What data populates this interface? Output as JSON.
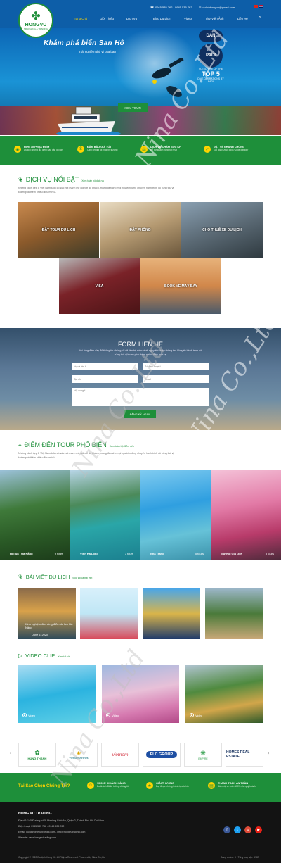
{
  "header": {
    "logo": {
      "name": "HONGVU",
      "tagline": "TRAVELING & TRADING"
    },
    "phone": "0945 535 762 - 0945 535 762",
    "email": "dulichhongvu@gmail.com",
    "nav": [
      "Trang Chủ",
      "Giới Thiệu",
      "Dịch Vụ",
      "Blog Du Lịch",
      "Video",
      "Thư Viện Ảnh",
      "Liên Hệ"
    ],
    "active_nav": "Trang Chủ",
    "colors": {
      "primary_blue": "#0d5ea8",
      "primary_green": "#1e8f3a",
      "accent_yellow": "#ffd400"
    }
  },
  "hero": {
    "title": "Khám phá biển San Hô",
    "subtitle": "Trải nghiệm thú vị của bạn",
    "button": "XEM TOUR",
    "badge_dan": "DAN",
    "badge_padi": "PADI",
    "rank_top": "VOTED ONE OF THE",
    "rank_big": "TOP 5",
    "rank_bottom": "DIVE OPERATIONS BY PADI"
  },
  "features": [
    {
      "title": "HƠN 300+ ĐỊA ĐIỂM",
      "desc": "Du lịch những địa điểm hấp dẫn du lịch",
      "icon": "map-icon"
    },
    {
      "title": "ĐẢM BẢO GIÁ TỐT",
      "desc": "Cam kết giá tốt nhất thị trường",
      "icon": "money-bag-icon"
    },
    {
      "title": "DỊCH VỤ CHĂM SÓC KH",
      "desc": "Hỗ trợ khách hàng tốt nhất",
      "icon": "support-icon"
    },
    {
      "title": "ĐẶT VÉ NHANH CHÓNG",
      "desc": "Gọi ngay 0945 535 762 để đặt tour",
      "icon": "thumbs-up-icon"
    }
  ],
  "services": {
    "title": "DỊCH VỤ NỔI BẬT",
    "link": "Xem toàn bộ dịch vụ",
    "desc": "Những cảnh đẹp ở Việt Nam luôn có sức hút mạnh mẽ đối với du khách, mang đến cho mọi người những chuyến hành trình vô cùng thú vị khám phá thêm nhiều điều mới lạ.",
    "items": [
      "ĐẶT TOUR DU LỊCH",
      "ĐẶT PHÒNG",
      "CHO THUÊ XE DU LỊCH",
      "VISA",
      "BOOK VÉ MÁY BAY"
    ]
  },
  "form": {
    "title": "FORM LIÊN HỆ",
    "desc": "Vui lòng điền đầy đủ thông tin chúng tôi sẽ liên hệ sớm nhất ngay khi nhận thông tin. Chuyến hành trình vô cùng thú vị khám phá thêm nhiều điều mới lạ.",
    "placeholders": {
      "name": "Họ và tên *",
      "phone": "Số điện thoại *",
      "address": "Địa chỉ",
      "email": "Email",
      "content": "Nội dung *"
    },
    "button": "ĐĂNG KÝ NGAY"
  },
  "destinations": {
    "title": "ĐIỂM ĐẾN TOUR PHỔ BIẾN",
    "link": "Xem toàn bộ điểm đến",
    "desc": "Những cảnh đẹp ở Việt Nam luôn có sức hút mạnh mẽ đối với du khách, mang đến cho mọi người những chuyến hành trình vô cùng thú vị khám phá thêm nhiều điều mới lạ.",
    "items": [
      {
        "name": "Hội An - Đà Nẵng",
        "tours": "9 tours"
      },
      {
        "name": "Vịnh Hạ Long",
        "tours": "7 tours"
      },
      {
        "name": "Nha Trang",
        "tours": "5 tours"
      },
      {
        "name": "Trương Gia Giới",
        "tours": "3 tours"
      }
    ]
  },
  "blog": {
    "title": "BÀI VIẾT DU LỊCH",
    "link": "Đọc tất cả bài viết",
    "featured_caption": "Kinh nghiệm & những điểm du lịch Đà Nẵng",
    "featured_date": "June 6, 2020"
  },
  "videos": {
    "title": "VIDEO CLIP",
    "link": "Xem tất cả",
    "items": [
      "Video",
      "Video",
      "Video"
    ]
  },
  "partners": [
    "HÙNG THÀNH",
    "Vietnam Airlines",
    "vietnam",
    "FLC GROUP",
    "EMPIRE",
    "HOMES REAL ESTATE"
  ],
  "why": {
    "title": "Tại Sao Chọn Chúng Tôi?",
    "items": [
      {
        "title": "10.000+ KHÁCH HÀNG",
        "desc": "Du khách đã tin tưởng chúng tôi",
        "icon": "users-icon"
      },
      {
        "title": "GIẢI THƯỞNG",
        "desc": "Đạt được những thành tựu to lớn",
        "icon": "medal-icon"
      },
      {
        "title": "THANH TOÁN AN TOÀN",
        "desc": "Bảo mật an toàn 100% cho quý khách",
        "icon": "payment-icon"
      }
    ]
  },
  "footer": {
    "company": "HONG VU TRADING",
    "address": "Địa chỉ: 145 Đường số 5, Phường Bình An, Quận 2, Thành Phố Hồ Chí Minh",
    "phone": "Điện thoại: 0945 535 762 - 0945 535 762",
    "email": "Email: dulichhongvu@gmail.com - info@hongvutrading.com",
    "website": "Website: www.hongvutrading.com",
    "copyright": "Copyright © 2020 Du Lịch Hồng Vũ. All Rights Reserved. Powered by Nina Co.,Ltd",
    "stats": "Đang online: 9  |  Tổng truy cập: 6789"
  },
  "watermark": "Nina Co.,Ltd"
}
